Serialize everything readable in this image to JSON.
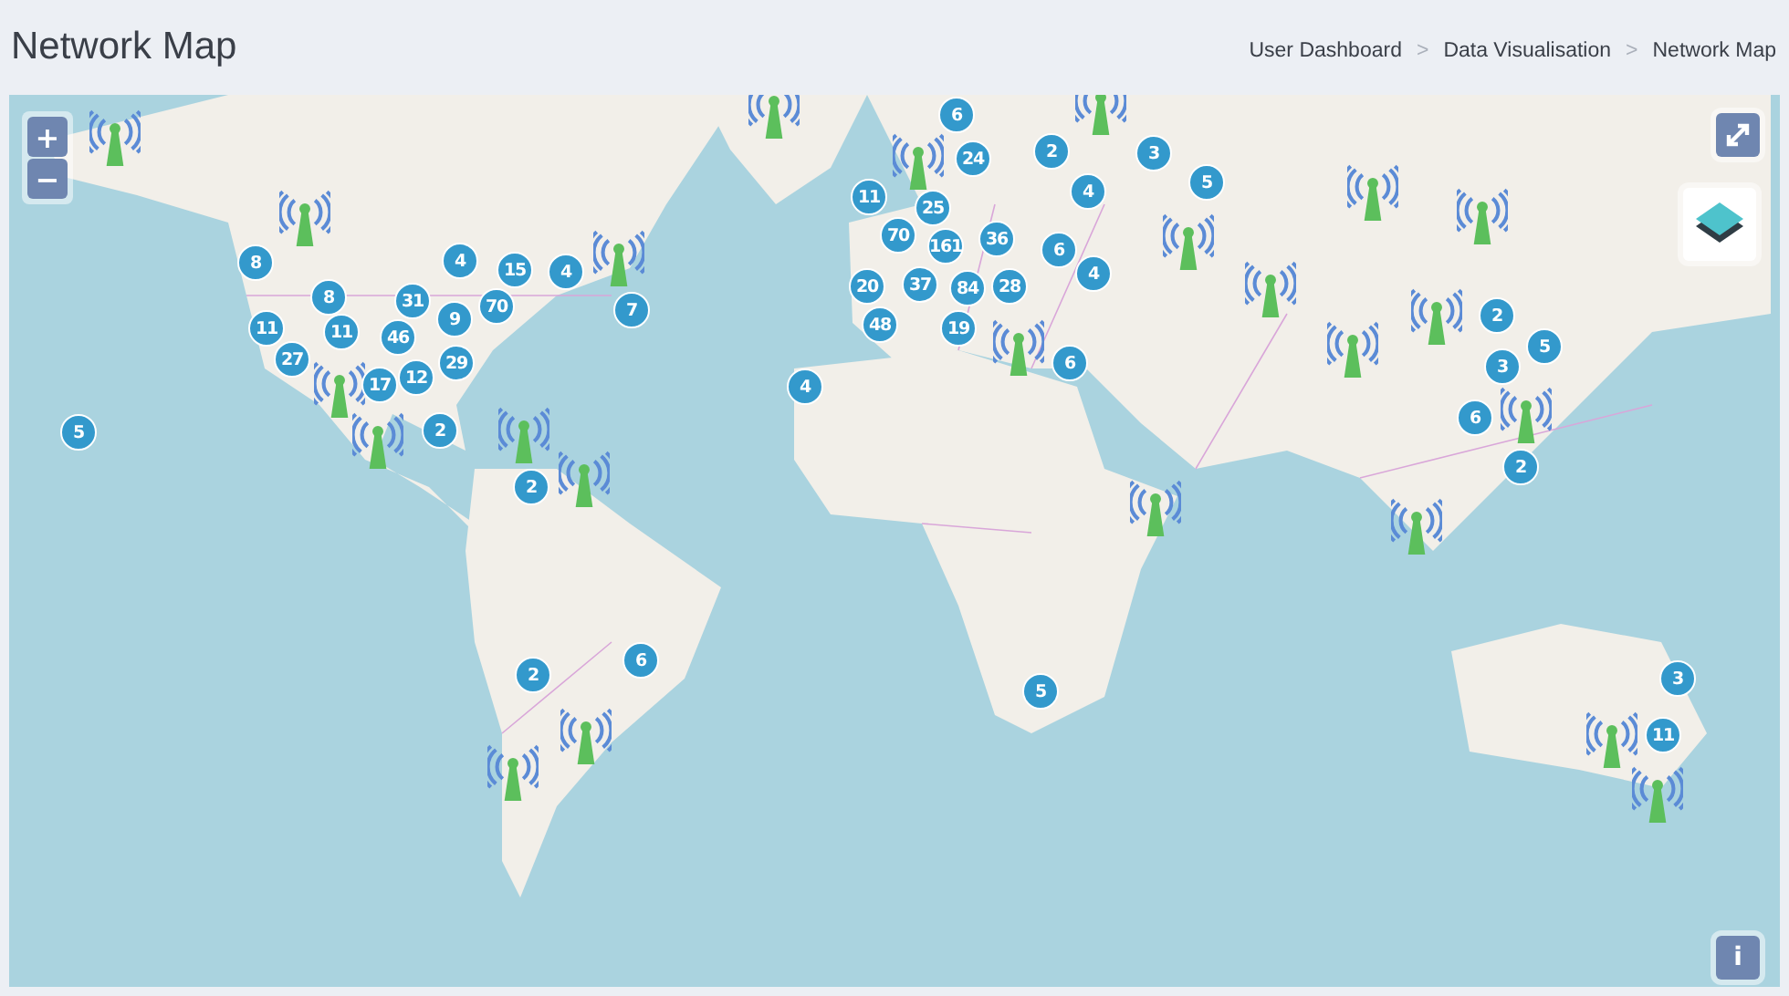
{
  "page": {
    "title": "Network Map"
  },
  "breadcrumb": {
    "separator": ">",
    "items": [
      "User Dashboard",
      "Data Visualisation",
      "Network Map"
    ]
  },
  "map": {
    "kind": "picture",
    "zoom_in": "+",
    "zoom_out": "−",
    "info": "i",
    "clusters": [
      {
        "count": "6"
      },
      {
        "count": "24"
      },
      {
        "count": "2"
      },
      {
        "count": "3"
      },
      {
        "count": "11"
      },
      {
        "count": "4"
      },
      {
        "count": "5"
      },
      {
        "count": "25"
      },
      {
        "count": "70"
      },
      {
        "count": "161"
      },
      {
        "count": "36"
      },
      {
        "count": "6"
      },
      {
        "count": "8"
      },
      {
        "count": "4"
      },
      {
        "count": "15"
      },
      {
        "count": "4"
      },
      {
        "count": "4"
      },
      {
        "count": "20"
      },
      {
        "count": "37"
      },
      {
        "count": "84"
      },
      {
        "count": "28"
      },
      {
        "count": "8"
      },
      {
        "count": "31"
      },
      {
        "count": "9"
      },
      {
        "count": "70"
      },
      {
        "count": "7"
      },
      {
        "count": "48"
      },
      {
        "count": "2"
      },
      {
        "count": "11"
      },
      {
        "count": "11"
      },
      {
        "count": "46"
      },
      {
        "count": "19"
      },
      {
        "count": "5"
      },
      {
        "count": "27"
      },
      {
        "count": "29"
      },
      {
        "count": "6"
      },
      {
        "count": "3"
      },
      {
        "count": "17"
      },
      {
        "count": "12"
      },
      {
        "count": "4"
      },
      {
        "count": "6"
      },
      {
        "count": "5"
      },
      {
        "count": "2"
      },
      {
        "count": "2"
      },
      {
        "count": "2"
      },
      {
        "count": "6"
      },
      {
        "count": "2"
      },
      {
        "count": "3"
      },
      {
        "count": "5"
      },
      {
        "count": "11"
      }
    ]
  }
}
